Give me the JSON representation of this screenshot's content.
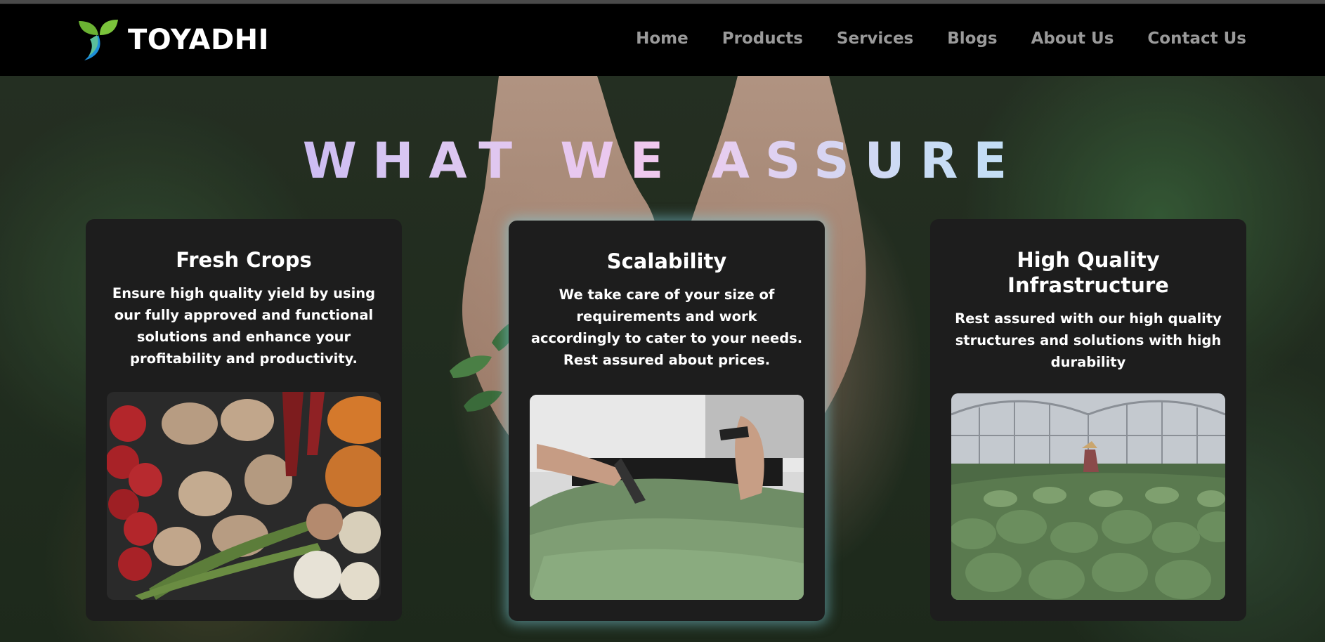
{
  "brand": {
    "name": "TOYADHI"
  },
  "nav": {
    "items": [
      {
        "label": "Home"
      },
      {
        "label": "Products"
      },
      {
        "label": "Services"
      },
      {
        "label": "Blogs"
      },
      {
        "label": "About Us"
      },
      {
        "label": "Contact Us"
      }
    ]
  },
  "hero": {
    "title": "WHAT WE ASSURE"
  },
  "cards": [
    {
      "title": "Fresh Crops",
      "text": "Ensure high quality yield by using our fully approved and functional solutions and enhance your profitability and productivity."
    },
    {
      "title": "Scalability",
      "text": "We take care of your size of requirements and work accordingly to cater to your needs. Rest assured about prices."
    },
    {
      "title": "High Quality Infrastructure",
      "text": "Rest assured with our high quality structures and solutions with high durability"
    }
  ],
  "colors": {
    "nav_text": "#9a9a9a",
    "card_bg": "#1d1d1d",
    "glow": "#7dd2e1",
    "logo_green": "#79c13a",
    "logo_blue": "#1d8fd8"
  }
}
